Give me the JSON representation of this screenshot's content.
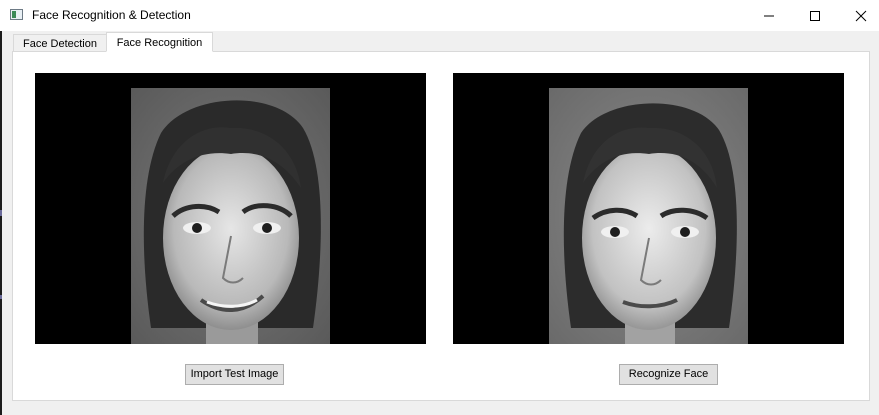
{
  "window": {
    "title": "Face Recognition & Detection",
    "icon": "app-window-icon",
    "controls": [
      "minimize-icon",
      "maximize-icon",
      "close-icon"
    ]
  },
  "tabs": [
    {
      "label": "Face Detection",
      "active": false
    },
    {
      "label": "Face Recognition",
      "active": true
    }
  ],
  "panel": {
    "test_image": {
      "content": "grayscale face photo (test image)",
      "icon": "face-photo"
    },
    "result_image": {
      "content": "grayscale face photo (recognized match)",
      "icon": "face-photo"
    },
    "import_button": "Import Test Image",
    "recognize_button": "Recognize Face"
  },
  "colors": {
    "image_background": "#000000",
    "button_face": "#e1e1e1",
    "panel_background": "#ffffff"
  }
}
